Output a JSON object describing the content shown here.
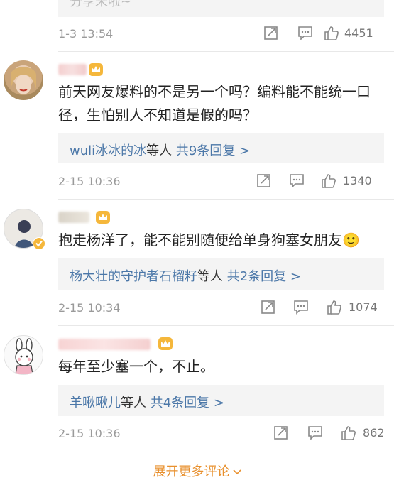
{
  "top_reply_box": {
    "partial_text": "分享来啦~"
  },
  "comments": [
    {
      "time": "1-3 13:54",
      "likes": "4451"
    },
    {
      "text_line1": "前天网友爆料的不是另一个吗？编料能不能统一口",
      "text_line2": "径，生怕别人不知道是假的吗？",
      "reply_names": "wuli冰冰的冰",
      "reply_mid": "等人",
      "reply_count": "共9条回复 >",
      "time": "2-15 10:36",
      "likes": "1340"
    },
    {
      "text": "抱走杨洋了，能不能别随便给单身狗塞女朋友",
      "emoji": "🙂",
      "reply_names": "杨大壮的守护者石榴籽",
      "reply_mid": "等人",
      "reply_count": "共2条回复 >",
      "time": "2-15 10:34",
      "likes": "1074"
    },
    {
      "text": "每年至少塞一个，不止。",
      "reply_names": "羊啾啾儿",
      "reply_mid": "等人",
      "reply_count": "共4条回复 >",
      "time": "2-15 10:36",
      "likes": "862"
    }
  ],
  "footer": {
    "expand_label": "展开更多评论"
  },
  "colors": {
    "link": "#4b77a8",
    "accent": "#e8902e",
    "meta": "#9a9a9a",
    "reply_bg": "#f4f4f4"
  }
}
